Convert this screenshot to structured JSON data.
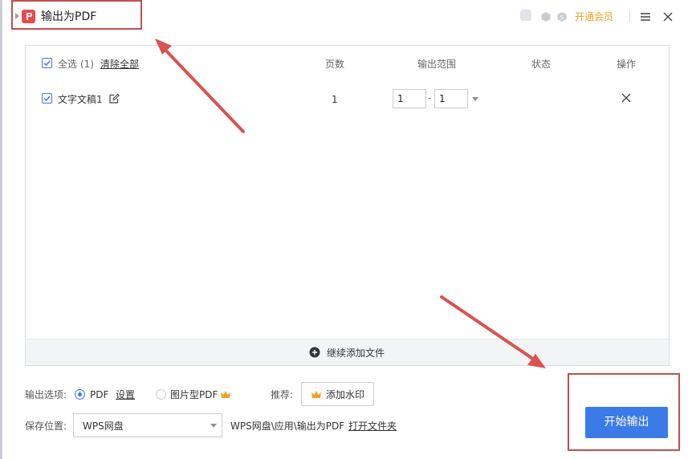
{
  "window": {
    "title": "输出为PDF",
    "vip_label": "开通会员",
    "accent_color": "#3b7be8",
    "vip_color": "#f0a020",
    "annotation_color": "#c0504d"
  },
  "file_list": {
    "select_all_label": "全选",
    "select_count": "(1)",
    "clear_all_label": "清除全部",
    "columns": {
      "pages": "页数",
      "output_range": "输出范围",
      "status": "状态",
      "actions": "操作"
    },
    "rows": [
      {
        "name": "文字文稿1",
        "pages": "1",
        "range_from": "1",
        "range_to": "1",
        "range_separator": "-",
        "status": "",
        "checked": true
      }
    ],
    "add_more_label": "继续添加文件"
  },
  "options": {
    "output_options_label": "输出选项:",
    "pdf_label": "PDF",
    "settings_label": "设置",
    "image_pdf_label": "图片型PDF",
    "recommend_label": "推荐:",
    "watermark_label": "添加水印",
    "selected_output": "PDF"
  },
  "save": {
    "label": "保存位置:",
    "location_value": "WPS网盘",
    "path_text": "WPS网盘\\应用\\输出为PDF",
    "open_folder_label": "打开文件夹"
  },
  "actions": {
    "start_label": "开始输出"
  }
}
